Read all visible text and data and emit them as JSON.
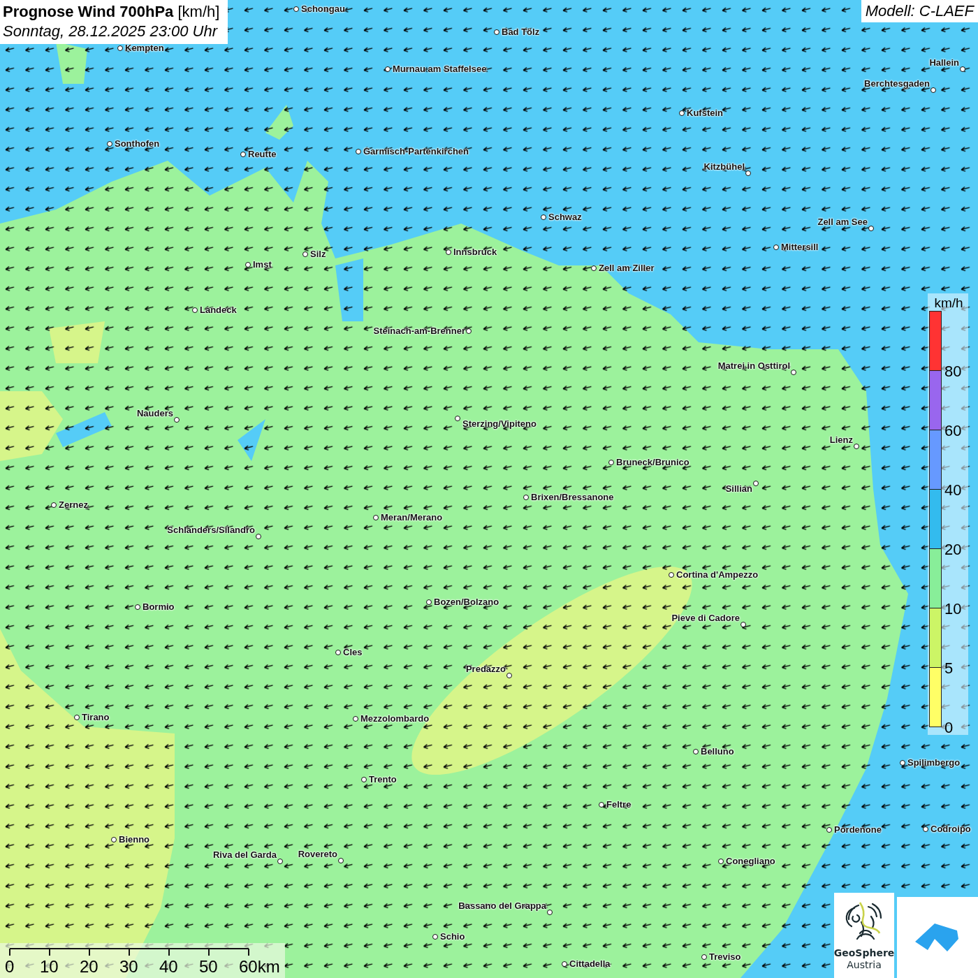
{
  "header": {
    "title": "Prognose Wind 700hPa",
    "unit": "[km/h]",
    "datetime": "Sonntag, 28.12.2025 23:00 Uhr"
  },
  "model": "Modell: C-LAEF",
  "cities": [
    {
      "name": "Schongau"
    },
    {
      "name": "Bad Tölz"
    },
    {
      "name": "Kempten"
    },
    {
      "name": "Murnau am Staffelsee"
    },
    {
      "name": "Hallein"
    },
    {
      "name": "Berchtesgaden"
    },
    {
      "name": "Kufstein"
    },
    {
      "name": "Sonthofen"
    },
    {
      "name": "Reutte"
    },
    {
      "name": "Garmisch-Partenkirchen"
    },
    {
      "name": "Kitzbühel"
    },
    {
      "name": "Schwaz"
    },
    {
      "name": "Zell am See"
    },
    {
      "name": "Mittersill"
    },
    {
      "name": "Innsbruck"
    },
    {
      "name": "Silz"
    },
    {
      "name": "Imst"
    },
    {
      "name": "Zell am Ziller"
    },
    {
      "name": "Landeck"
    },
    {
      "name": "Steinach-am-Brenner"
    },
    {
      "name": "Matrei in Osttirol"
    },
    {
      "name": "Nauders"
    },
    {
      "name": "Sterzing/Vipiteno"
    },
    {
      "name": "Lienz"
    },
    {
      "name": "Bruneck/Brunico"
    },
    {
      "name": "Sillian"
    },
    {
      "name": "Brixen/Bressanone"
    },
    {
      "name": "Zernez"
    },
    {
      "name": "Meran/Merano"
    },
    {
      "name": "Schlanders/Silandro"
    },
    {
      "name": "Cortina d'Ampezzo"
    },
    {
      "name": "Bozen/Bolzano"
    },
    {
      "name": "Bormio"
    },
    {
      "name": "Pieve di Cadore"
    },
    {
      "name": "Cles"
    },
    {
      "name": "Predazzo"
    },
    {
      "name": "Tirano"
    },
    {
      "name": "Mezzolombardo"
    },
    {
      "name": "Belluno"
    },
    {
      "name": "Spilimbergo"
    },
    {
      "name": "Trento"
    },
    {
      "name": "Feltre"
    },
    {
      "name": "Pordenone"
    },
    {
      "name": "Codroipo"
    },
    {
      "name": "Bienno"
    },
    {
      "name": "Riva del Garda"
    },
    {
      "name": "Rovereto"
    },
    {
      "name": "Conegliano"
    },
    {
      "name": "Bassano del Grappa"
    },
    {
      "name": "Schio"
    },
    {
      "name": "Treviso"
    },
    {
      "name": "Cittadella"
    }
  ],
  "legend": {
    "unit": "km/h",
    "classes": [
      {
        "label": "80",
        "color": "#ff3333"
      },
      {
        "label": "60",
        "color": "#9966ee"
      },
      {
        "label": "40",
        "color": "#6699ff"
      },
      {
        "label": "20",
        "color": "#33bbee"
      },
      {
        "label": "10",
        "color": "#88ee99"
      },
      {
        "label": "5",
        "color": "#ccf566"
      },
      {
        "label": "0",
        "color": "#ffff66"
      }
    ]
  },
  "scale": {
    "ticks": [
      "0",
      "10",
      "20",
      "30",
      "40",
      "50",
      "60km"
    ]
  },
  "logo": {
    "name": "GeoSphere",
    "subtitle": "Austria"
  }
}
